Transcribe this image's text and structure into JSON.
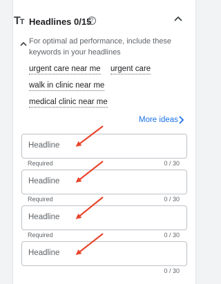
{
  "section": {
    "icon": "text-format-icon",
    "title": "Headlines 0/15",
    "help_glyph": "?",
    "hint": "For optimal ad performance, include these keywords in your headlines"
  },
  "keywords": [
    "urgent care near me",
    "urgent care",
    "walk in clinic near me",
    "medical clinic near me"
  ],
  "more_ideas_label": "More ideas",
  "headline_fields": [
    {
      "placeholder": "Headline",
      "required_label": "Required",
      "counter": "0 / 30"
    },
    {
      "placeholder": "Headline",
      "required_label": "Required",
      "counter": "0 / 30"
    },
    {
      "placeholder": "Headline",
      "required_label": "Required",
      "counter": "0 / 30"
    },
    {
      "placeholder": "Headline",
      "required_label": "",
      "counter": "0 / 30"
    }
  ],
  "colors": {
    "accent": "#1a73e8",
    "annotation_arrow": "#e8452c",
    "field_border": "#bdc1c6"
  }
}
